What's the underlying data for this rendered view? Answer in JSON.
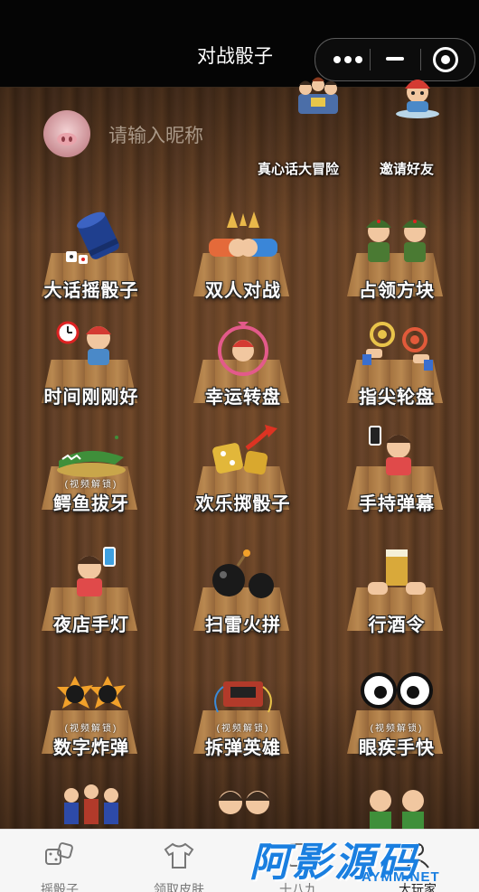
{
  "header": {
    "title": "对战骰子"
  },
  "profile": {
    "nickname_placeholder": "请输入昵称"
  },
  "top_actions": [
    {
      "label": "真心话大冒险",
      "icon": "party-people-icon"
    },
    {
      "label": "邀请好友",
      "icon": "invite-friend-icon"
    }
  ],
  "games": [
    {
      "label": "大话摇骰子",
      "icon": "dice-cup-icon"
    },
    {
      "label": "双人对战",
      "icon": "fist-bump-icon"
    },
    {
      "label": "占领方块",
      "icon": "soldiers-icon"
    },
    {
      "label": "时间刚刚好",
      "icon": "alarm-clock-icon"
    },
    {
      "label": "幸运转盘",
      "icon": "lucky-wheel-icon"
    },
    {
      "label": "指尖轮盘",
      "icon": "finger-tap-icon"
    },
    {
      "label": "鳄鱼拔牙",
      "icon": "crocodile-icon",
      "sub": "(视频解锁)"
    },
    {
      "label": "欢乐掷骰子",
      "icon": "gold-dice-icon"
    },
    {
      "label": "手持弹幕",
      "icon": "phone-scroll-icon"
    },
    {
      "label": "夜店手灯",
      "icon": "glow-phone-icon"
    },
    {
      "label": "扫雷火拼",
      "icon": "bomb-icon"
    },
    {
      "label": "行酒令",
      "icon": "beer-toast-icon"
    },
    {
      "label": "数字炸弹",
      "icon": "number-bomb-icon",
      "sub": "(视频解锁)"
    },
    {
      "label": "拆弹英雄",
      "icon": "dynamite-icon",
      "sub": "(视频解锁)"
    },
    {
      "label": "眼疾手快",
      "icon": "big-eyes-icon",
      "sub": "(视频解锁)"
    }
  ],
  "tabbar": [
    {
      "label": "摇骰子",
      "icon": "dice-icon"
    },
    {
      "label": "领取皮肤",
      "icon": "tshirt-icon"
    },
    {
      "label": "十八九",
      "icon": "cards-icon"
    },
    {
      "label": "大玩家",
      "icon": "player-icon"
    }
  ],
  "watermark": {
    "main": "阿影源码",
    "sub": "AYMM.NET"
  },
  "colors": {
    "wood": "#5a3a22",
    "watermark": "#1a7fe0"
  }
}
